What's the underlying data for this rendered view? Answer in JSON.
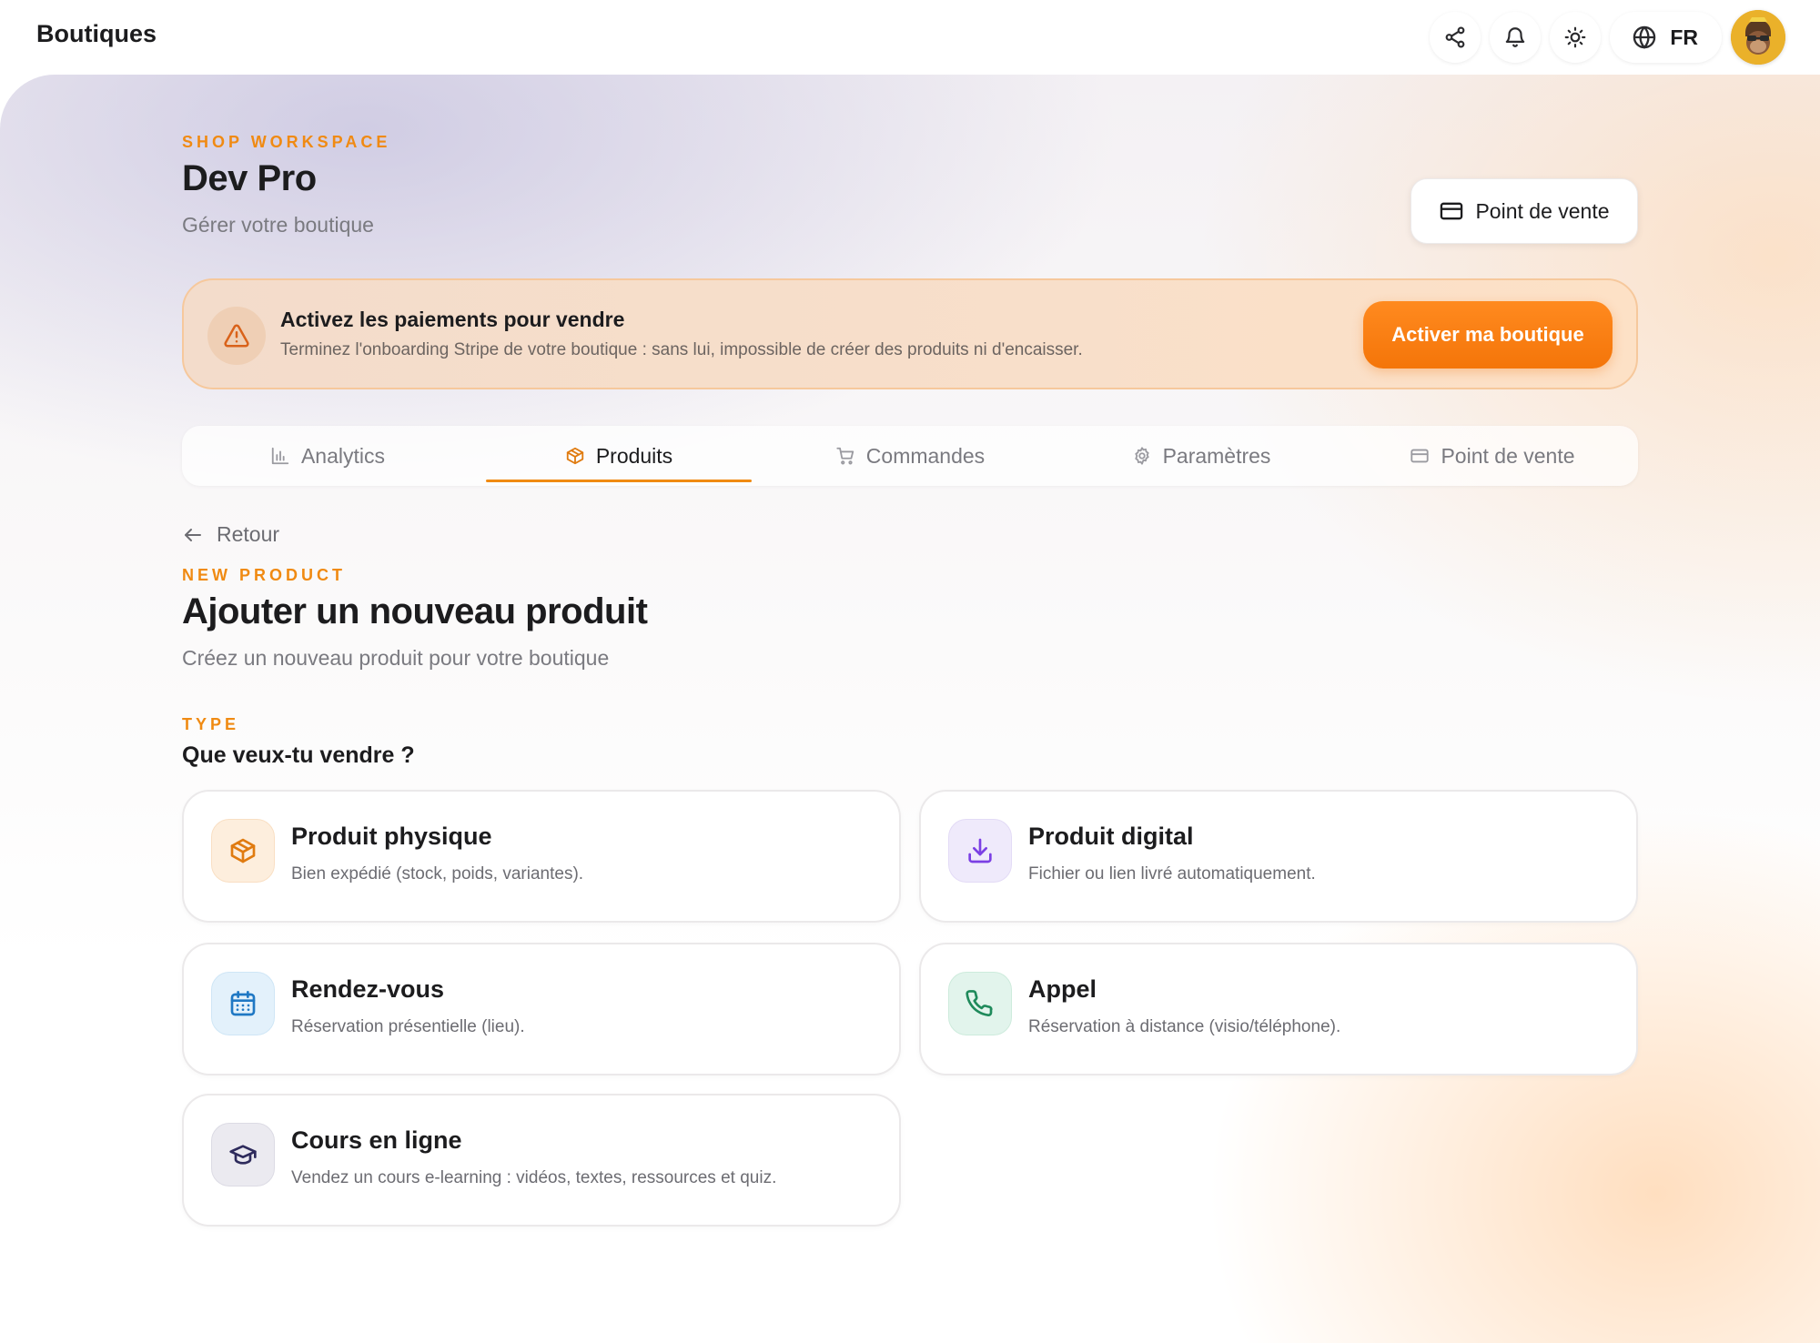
{
  "app": {
    "title": "Boutiques"
  },
  "topbar": {
    "language": "FR",
    "icons": [
      "share-icon",
      "bell-icon",
      "sun-icon",
      "globe-icon"
    ]
  },
  "shop": {
    "eyebrow": "SHOP WORKSPACE",
    "name": "Dev Pro",
    "subtitle": "Gérer votre boutique",
    "pos_button": "Point de vente"
  },
  "alert": {
    "title": "Activez les paiements pour vendre",
    "text": "Terminez l'onboarding Stripe de votre boutique : sans lui, impossible de créer des produits ni d'encaisser.",
    "button": "Activer ma boutique"
  },
  "tabs": [
    {
      "label": "Analytics",
      "icon": "chart-icon",
      "active": false
    },
    {
      "label": "Produits",
      "icon": "box-icon",
      "active": true
    },
    {
      "label": "Commandes",
      "icon": "cart-icon",
      "active": false
    },
    {
      "label": "Paramètres",
      "icon": "gear-icon",
      "active": false
    },
    {
      "label": "Point de vente",
      "icon": "card-icon",
      "active": false
    }
  ],
  "back": {
    "label": "Retour"
  },
  "new_product": {
    "eyebrow": "NEW PRODUCT",
    "title": "Ajouter un nouveau produit",
    "subtitle": "Créez un nouveau produit pour votre boutique"
  },
  "type": {
    "eyebrow": "TYPE",
    "question": "Que veux-tu vendre ?",
    "options": [
      {
        "title": "Produit physique",
        "desc": "Bien expédié (stock, poids, variantes).",
        "icon": "box-icon",
        "color": "#e07b10"
      },
      {
        "title": "Produit digital",
        "desc": "Fichier ou lien livré automatiquement.",
        "icon": "download-icon",
        "color": "#7b3fe4"
      },
      {
        "title": "Rendez-vous",
        "desc": "Réservation présentielle (lieu).",
        "icon": "calendar-icon",
        "color": "#1f78c4"
      },
      {
        "title": "Appel",
        "desc": "Réservation à distance (visio/téléphone).",
        "icon": "phone-icon",
        "color": "#1f8a5b"
      },
      {
        "title": "Cours en ligne",
        "desc": "Vendez un cours e-learning : vidéos, textes, ressources et quiz.",
        "icon": "graduation-cap-icon",
        "color": "#2e2b5c"
      }
    ]
  },
  "colors": {
    "accent": "#f08a12",
    "button": "#f47509"
  }
}
